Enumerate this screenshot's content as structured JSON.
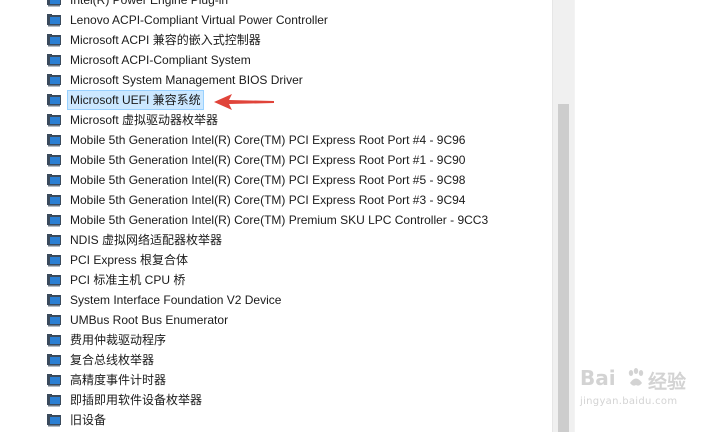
{
  "device_manager": {
    "items": [
      {
        "label": "Intel(R) Power Engine Plug-in",
        "icon": "device-folder-icon",
        "selected": false
      },
      {
        "label": "Lenovo ACPI-Compliant Virtual Power Controller",
        "icon": "device-folder-icon",
        "selected": false
      },
      {
        "label": "Microsoft ACPI 兼容的嵌入式控制器",
        "icon": "device-folder-icon",
        "selected": false
      },
      {
        "label": "Microsoft ACPI-Compliant System",
        "icon": "device-folder-icon",
        "selected": false
      },
      {
        "label": "Microsoft System Management BIOS Driver",
        "icon": "device-folder-icon",
        "selected": false
      },
      {
        "label": "Microsoft UEFI 兼容系统",
        "icon": "device-folder-icon",
        "selected": true
      },
      {
        "label": "Microsoft 虚拟驱动器枚举器",
        "icon": "device-folder-icon",
        "selected": false
      },
      {
        "label": "Mobile 5th Generation Intel(R) Core(TM) PCI Express Root Port #4 - 9C96",
        "icon": "device-folder-icon",
        "selected": false
      },
      {
        "label": "Mobile 5th Generation Intel(R) Core(TM) PCI Express Root Port #1 - 9C90",
        "icon": "device-folder-icon",
        "selected": false
      },
      {
        "label": "Mobile 5th Generation Intel(R) Core(TM) PCI Express Root Port #5 - 9C98",
        "icon": "device-folder-icon",
        "selected": false
      },
      {
        "label": "Mobile 5th Generation Intel(R) Core(TM) PCI Express Root Port #3 - 9C94",
        "icon": "device-folder-icon",
        "selected": false
      },
      {
        "label": "Mobile 5th Generation Intel(R) Core(TM) Premium SKU LPC Controller - 9CC3",
        "icon": "device-folder-icon",
        "selected": false
      },
      {
        "label": "NDIS 虚拟网络适配器枚举器",
        "icon": "device-folder-icon",
        "selected": false
      },
      {
        "label": "PCI Express 根复合体",
        "icon": "device-folder-icon",
        "selected": false
      },
      {
        "label": "PCI 标准主机 CPU 桥",
        "icon": "device-folder-icon",
        "selected": false
      },
      {
        "label": "System Interface Foundation V2 Device",
        "icon": "device-folder-icon",
        "selected": false
      },
      {
        "label": "UMBus Root Bus Enumerator",
        "icon": "device-folder-icon",
        "selected": false
      },
      {
        "label": "费用仲裁驱动程序",
        "icon": "device-folder-icon",
        "selected": false
      },
      {
        "label": "复合总线枚举器",
        "icon": "device-folder-icon",
        "selected": false
      },
      {
        "label": "高精度事件计时器",
        "icon": "device-folder-icon",
        "selected": false
      },
      {
        "label": "即插即用软件设备枚举器",
        "icon": "device-folder-icon",
        "selected": false
      },
      {
        "label": "旧设备",
        "icon": "device-folder-icon",
        "selected": false
      }
    ]
  },
  "annotation": {
    "arrow_color": "#e0443a",
    "icon": "red-arrow-icon"
  },
  "watermark": {
    "logo_text": "Bai",
    "logo_icon": "paw-icon",
    "logo_cn": "经验",
    "url": "jingyan.baidu.com"
  },
  "colors": {
    "selection_bg": "#cce8ff",
    "selection_border": "#99d1ff",
    "scrollbar_track": "#f0f0f0",
    "scrollbar_thumb": "#cdcdcd",
    "icon_blue": "#2b7fd3"
  }
}
